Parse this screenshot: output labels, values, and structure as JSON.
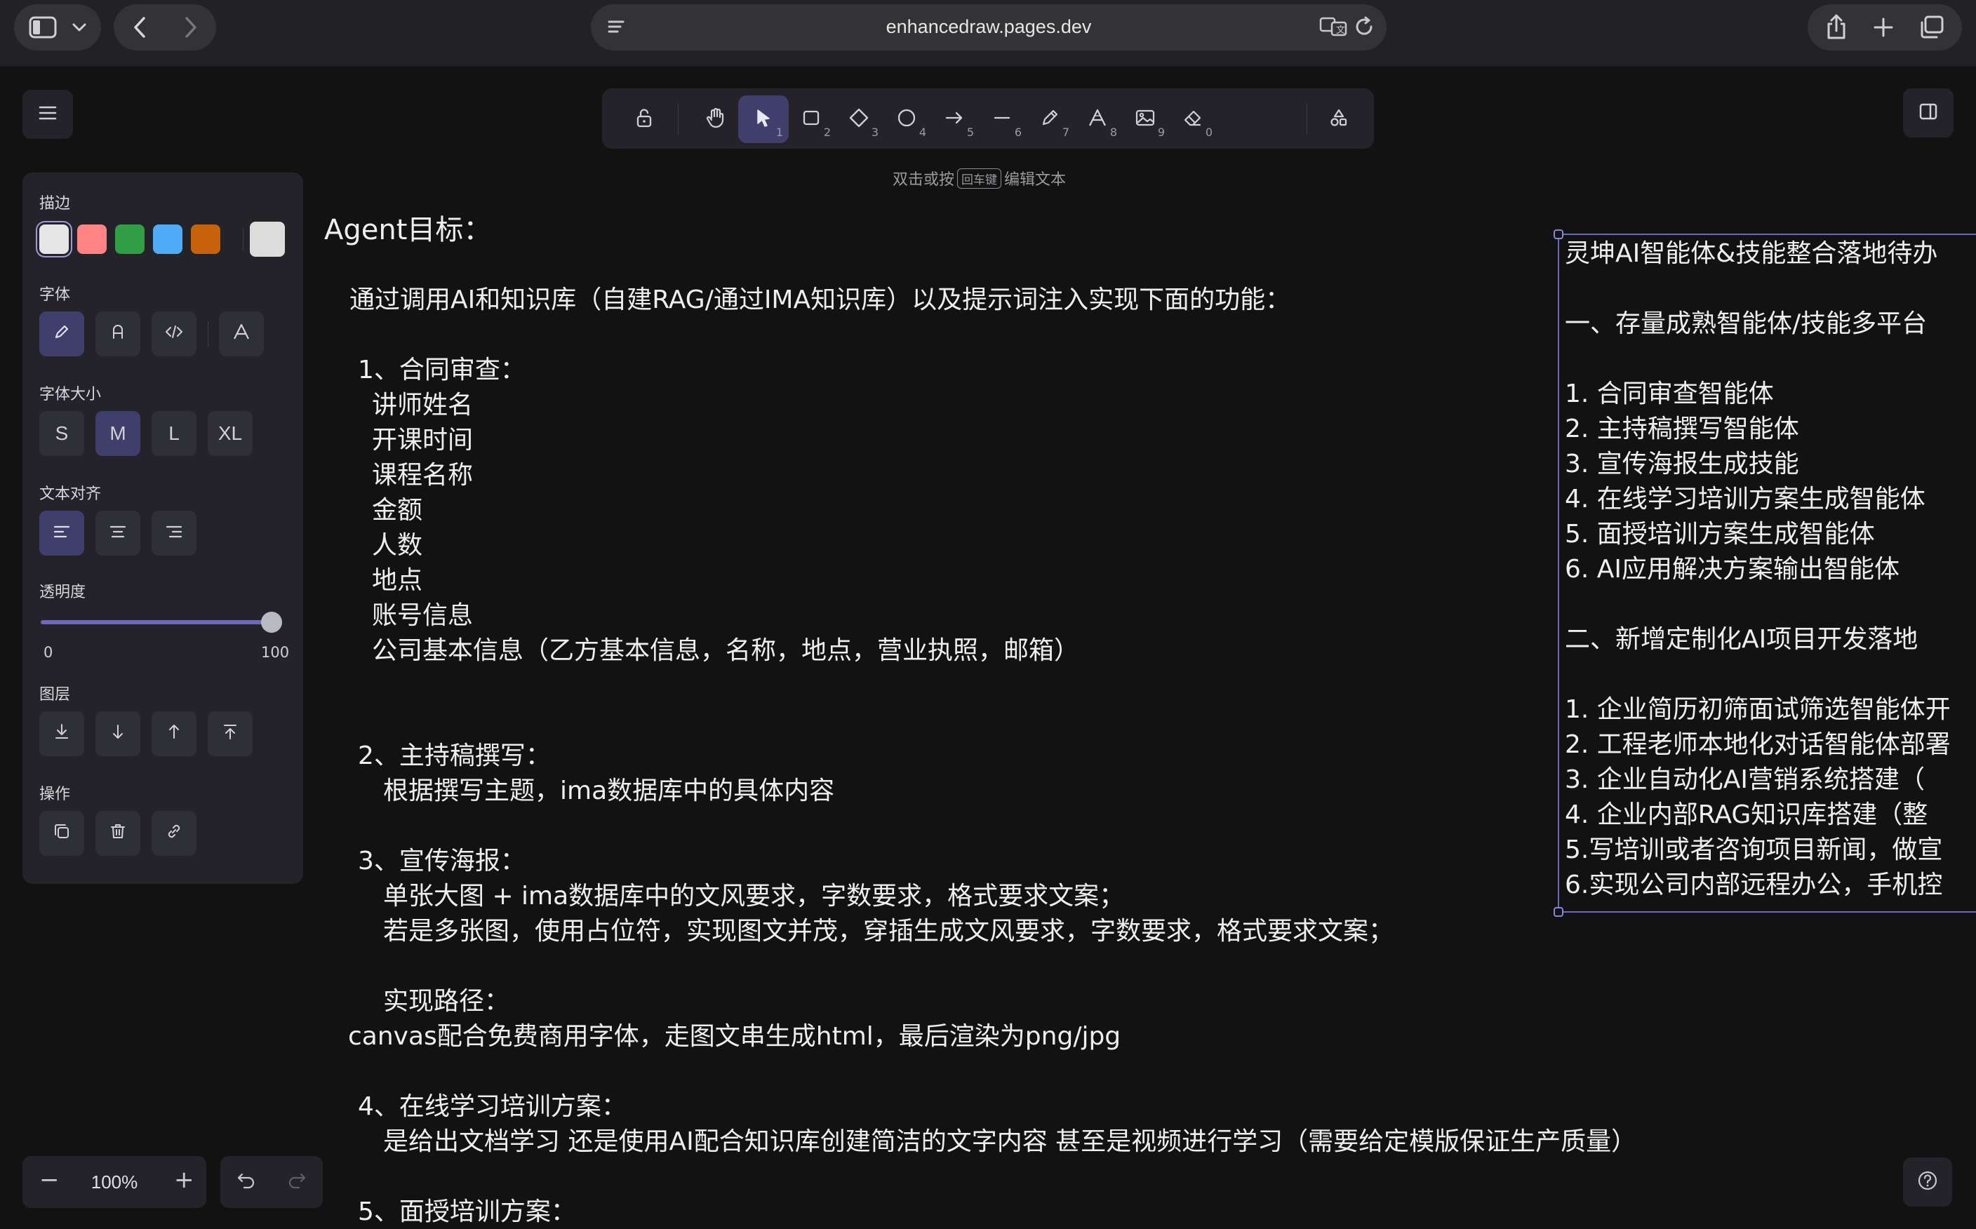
{
  "browser": {
    "url": "enhancedraw.pages.dev"
  },
  "hint": {
    "before": "双击或按",
    "key": "回车键",
    "after": "编辑文本"
  },
  "toolbar": {
    "tools": [
      {
        "name": "lock",
        "key": ""
      },
      {
        "name": "hand",
        "key": ""
      },
      {
        "name": "selection",
        "key": "1",
        "active": true
      },
      {
        "name": "rectangle",
        "key": "2"
      },
      {
        "name": "diamond",
        "key": "3"
      },
      {
        "name": "ellipse",
        "key": "4"
      },
      {
        "name": "arrow",
        "key": "5"
      },
      {
        "name": "line",
        "key": "6"
      },
      {
        "name": "draw",
        "key": "7"
      },
      {
        "name": "text",
        "key": "8"
      },
      {
        "name": "image",
        "key": "9"
      },
      {
        "name": "eraser",
        "key": "0"
      },
      {
        "name": "shapes-library",
        "key": ""
      }
    ]
  },
  "panel": {
    "stroke_label": "描边",
    "stroke_colors": [
      "#e6e6e6",
      "#ff8383",
      "#2f9e44",
      "#4dabf7",
      "#c8620a"
    ],
    "stroke_current": "#dcdcdc",
    "font_label": "字体",
    "font_size_label": "字体大小",
    "font_sizes": [
      "S",
      "M",
      "L",
      "XL"
    ],
    "font_size_active": "M",
    "text_align_label": "文本对齐",
    "opacity_label": "透明度",
    "opacity_min": "0",
    "opacity_max": "100",
    "opacity_value": 100,
    "layer_label": "图层",
    "actions_label": "操作"
  },
  "zoom": {
    "value": "100%",
    "minus": "−",
    "plus": "+"
  },
  "canvas": {
    "main_text": [
      "Agent目标：",
      "通过调用AI和知识库（自建RAG/通过IMA知识库）以及提示词注入实现下面的功能：",
      "1、合同审查：",
      "讲师姓名",
      "开课时间",
      "课程名称",
      "金额",
      "人数",
      "地点",
      "账号信息",
      "公司基本信息（乙方基本信息，名称，地点，营业执照，邮箱）",
      "2、主持稿撰写：",
      "根据撰写主题，ima数据库中的具体内容",
      "3、宣传海报：",
      "单张大图 + ima数据库中的文风要求，字数要求，格式要求文案；",
      "若是多张图，使用占位符，实现图文并茂，穿插生成文风要求，字数要求，格式要求文案；",
      "实现路径：",
      "canvas配合免费商用字体，走图文串生成html，最后渲染为png/jpg",
      "4、在线学习培训方案：",
      "是给出文档学习 还是使用AI配合知识库创建简洁的文字内容 甚至是视频进行学习（需要给定模版保证生产质量）",
      "5、面授培训方案："
    ],
    "right_text": [
      "灵坤AI智能体&技能整合落地待办",
      "一、存量成熟智能体/技能多平台",
      "1. 合同审查智能体",
      "2. 主持稿撰写智能体",
      "3. 宣传海报生成技能",
      "4. 在线学习培训方案生成智能体",
      "5. 面授培训方案生成智能体",
      "6. AI应用解决方案输出智能体",
      "二、新增定制化AI项目开发落地",
      "1. 企业简历初筛面试筛选智能体开",
      "2. 工程老师本地化对话智能体部署",
      "3. 企业自动化AI营销系统搭建（",
      "4. 企业内部RAG知识库搭建（整",
      "5.写培训或者咨询项目新闻，做宣",
      "6.实现公司内部远程办公，手机控"
    ]
  }
}
